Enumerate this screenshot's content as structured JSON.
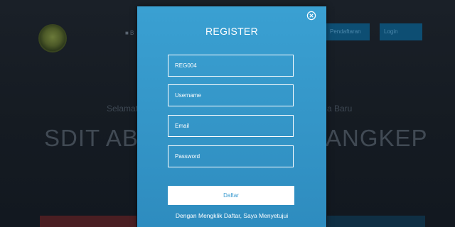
{
  "background": {
    "nav_dot": "■ B",
    "header_buttons": [
      "Pendaftaran",
      "Login"
    ],
    "welcome_left": "Selamat",
    "welcome_right": "a Baru",
    "school_left": "SDIT ABU",
    "school_right": "ANGKEP"
  },
  "modal": {
    "title": "REGISTER",
    "close_icon": "close-circle-icon",
    "fields": {
      "registration_id_value": "REG004",
      "username_placeholder": "Username",
      "email_placeholder": "Email",
      "password_placeholder": "Password"
    },
    "submit_label": "Daftar",
    "terms_text": "Dengan Mengklik Daftar, Saya Menyetujui"
  },
  "colors": {
    "modal_bg": "#3597c9",
    "button_text": "#3a9bd0",
    "backdrop": "#151b22"
  }
}
